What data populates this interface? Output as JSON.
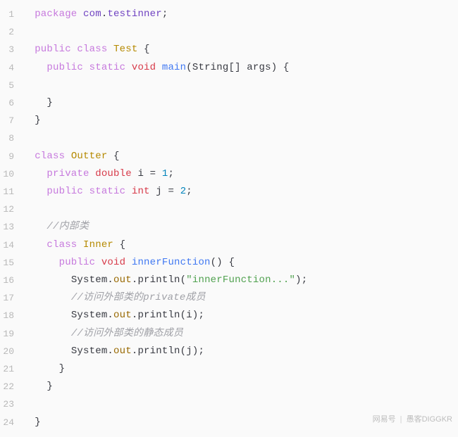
{
  "lines": [
    {
      "num": "1",
      "tokens": [
        {
          "t": "  ",
          "c": ""
        },
        {
          "t": "package",
          "c": "kw"
        },
        {
          "t": " ",
          "c": ""
        },
        {
          "t": "com",
          "c": "pkg"
        },
        {
          "t": ".",
          "c": "punct"
        },
        {
          "t": "testinner",
          "c": "pkg"
        },
        {
          "t": ";",
          "c": "punct"
        }
      ]
    },
    {
      "num": "2",
      "tokens": []
    },
    {
      "num": "3",
      "tokens": [
        {
          "t": "  ",
          "c": ""
        },
        {
          "t": "public",
          "c": "kw"
        },
        {
          "t": " ",
          "c": ""
        },
        {
          "t": "class",
          "c": "kw"
        },
        {
          "t": " ",
          "c": ""
        },
        {
          "t": "Test",
          "c": "classname"
        },
        {
          "t": " {",
          "c": "punct"
        }
      ]
    },
    {
      "num": "4",
      "tokens": [
        {
          "t": "    ",
          "c": ""
        },
        {
          "t": "public",
          "c": "kw"
        },
        {
          "t": " ",
          "c": ""
        },
        {
          "t": "static",
          "c": "kw"
        },
        {
          "t": " ",
          "c": ""
        },
        {
          "t": "void",
          "c": "type"
        },
        {
          "t": " ",
          "c": ""
        },
        {
          "t": "main",
          "c": "method"
        },
        {
          "t": "(",
          "c": "punct"
        },
        {
          "t": "String",
          "c": "dark"
        },
        {
          "t": "[] ",
          "c": "punct"
        },
        {
          "t": "args",
          "c": "var"
        },
        {
          "t": ") {",
          "c": "punct"
        }
      ]
    },
    {
      "num": "5",
      "tokens": []
    },
    {
      "num": "6",
      "tokens": [
        {
          "t": "    }",
          "c": "punct"
        }
      ]
    },
    {
      "num": "7",
      "tokens": [
        {
          "t": "  }",
          "c": "punct"
        }
      ]
    },
    {
      "num": "8",
      "tokens": []
    },
    {
      "num": "9",
      "tokens": [
        {
          "t": "  ",
          "c": ""
        },
        {
          "t": "class",
          "c": "kw"
        },
        {
          "t": " ",
          "c": ""
        },
        {
          "t": "Outter",
          "c": "classname"
        },
        {
          "t": " {",
          "c": "punct"
        }
      ]
    },
    {
      "num": "10",
      "tokens": [
        {
          "t": "    ",
          "c": ""
        },
        {
          "t": "private",
          "c": "kw"
        },
        {
          "t": " ",
          "c": ""
        },
        {
          "t": "double",
          "c": "type"
        },
        {
          "t": " ",
          "c": ""
        },
        {
          "t": "i",
          "c": "var"
        },
        {
          "t": " = ",
          "c": "punct"
        },
        {
          "t": "1",
          "c": "num"
        },
        {
          "t": ";",
          "c": "punct"
        }
      ]
    },
    {
      "num": "11",
      "tokens": [
        {
          "t": "    ",
          "c": ""
        },
        {
          "t": "public",
          "c": "kw"
        },
        {
          "t": " ",
          "c": ""
        },
        {
          "t": "static",
          "c": "kw"
        },
        {
          "t": " ",
          "c": ""
        },
        {
          "t": "int",
          "c": "type"
        },
        {
          "t": " ",
          "c": ""
        },
        {
          "t": "j",
          "c": "var"
        },
        {
          "t": " = ",
          "c": "punct"
        },
        {
          "t": "2",
          "c": "num"
        },
        {
          "t": ";",
          "c": "punct"
        }
      ]
    },
    {
      "num": "12",
      "tokens": []
    },
    {
      "num": "13",
      "tokens": [
        {
          "t": "    ",
          "c": ""
        },
        {
          "t": "//内部类",
          "c": "comment"
        }
      ]
    },
    {
      "num": "14",
      "tokens": [
        {
          "t": "    ",
          "c": ""
        },
        {
          "t": "class",
          "c": "kw"
        },
        {
          "t": " ",
          "c": ""
        },
        {
          "t": "Inner",
          "c": "classname"
        },
        {
          "t": " {",
          "c": "punct"
        }
      ]
    },
    {
      "num": "15",
      "tokens": [
        {
          "t": "      ",
          "c": ""
        },
        {
          "t": "public",
          "c": "kw"
        },
        {
          "t": " ",
          "c": ""
        },
        {
          "t": "void",
          "c": "type"
        },
        {
          "t": " ",
          "c": ""
        },
        {
          "t": "innerFunction",
          "c": "method"
        },
        {
          "t": "() {",
          "c": "punct"
        }
      ]
    },
    {
      "num": "16",
      "tokens": [
        {
          "t": "        ",
          "c": ""
        },
        {
          "t": "System",
          "c": "dark"
        },
        {
          "t": ".",
          "c": "punct"
        },
        {
          "t": "out",
          "c": "field"
        },
        {
          "t": ".",
          "c": "punct"
        },
        {
          "t": "println",
          "c": "dark"
        },
        {
          "t": "(",
          "c": "punct"
        },
        {
          "t": "\"innerFunction...\"",
          "c": "str"
        },
        {
          "t": ");",
          "c": "punct"
        }
      ]
    },
    {
      "num": "17",
      "tokens": [
        {
          "t": "        ",
          "c": ""
        },
        {
          "t": "//访问外部类的private成员",
          "c": "comment"
        }
      ]
    },
    {
      "num": "18",
      "tokens": [
        {
          "t": "        ",
          "c": ""
        },
        {
          "t": "System",
          "c": "dark"
        },
        {
          "t": ".",
          "c": "punct"
        },
        {
          "t": "out",
          "c": "field"
        },
        {
          "t": ".",
          "c": "punct"
        },
        {
          "t": "println",
          "c": "dark"
        },
        {
          "t": "(",
          "c": "punct"
        },
        {
          "t": "i",
          "c": "var"
        },
        {
          "t": ");",
          "c": "punct"
        }
      ]
    },
    {
      "num": "19",
      "tokens": [
        {
          "t": "        ",
          "c": ""
        },
        {
          "t": "//访问外部类的静态成员",
          "c": "comment"
        }
      ]
    },
    {
      "num": "20",
      "tokens": [
        {
          "t": "        ",
          "c": ""
        },
        {
          "t": "System",
          "c": "dark"
        },
        {
          "t": ".",
          "c": "punct"
        },
        {
          "t": "out",
          "c": "field"
        },
        {
          "t": ".",
          "c": "punct"
        },
        {
          "t": "println",
          "c": "dark"
        },
        {
          "t": "(",
          "c": "punct"
        },
        {
          "t": "j",
          "c": "var"
        },
        {
          "t": ");",
          "c": "punct"
        }
      ]
    },
    {
      "num": "21",
      "tokens": [
        {
          "t": "      }",
          "c": "punct"
        }
      ]
    },
    {
      "num": "22",
      "tokens": [
        {
          "t": "    }",
          "c": "punct"
        }
      ]
    },
    {
      "num": "23",
      "tokens": []
    },
    {
      "num": "24",
      "tokens": [
        {
          "t": "  }",
          "c": "punct"
        }
      ]
    }
  ],
  "watermark": {
    "left": "网易号",
    "right": "愚客DIGGKR"
  }
}
